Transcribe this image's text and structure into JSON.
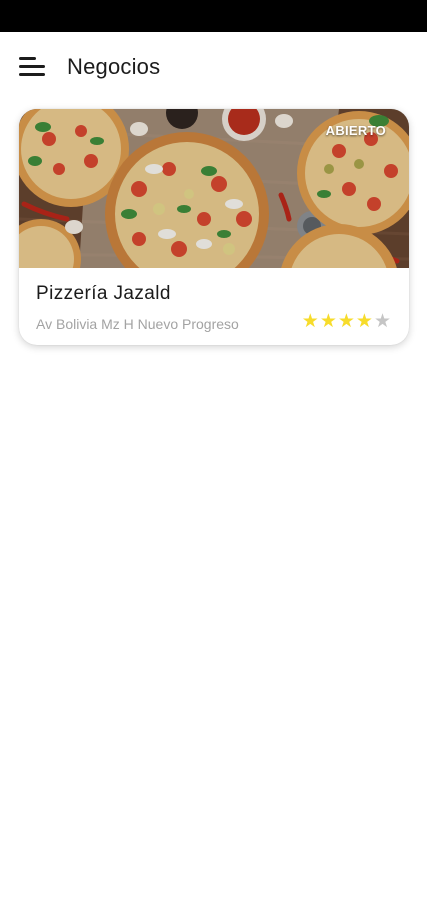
{
  "app_bar": {
    "title": "Negocios",
    "menu_icon": "menu-icon"
  },
  "businesses": [
    {
      "name": "Pizzería Jazald",
      "address": "Av Bolivia Mz H Nuevo Progreso",
      "status": "ABIERTO",
      "rating": 4,
      "rating_max": 5,
      "image": "pizza-photo"
    }
  ],
  "colors": {
    "star_filled": "#f7dc2b",
    "star_empty": "#c5c5c5",
    "status_bar": "#000000"
  }
}
